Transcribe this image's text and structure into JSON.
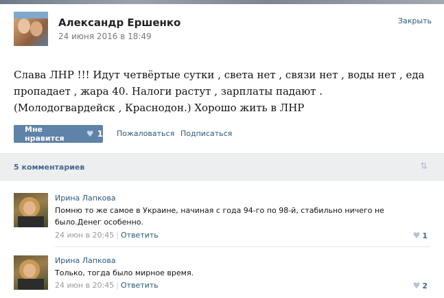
{
  "post": {
    "author_name": "Александр Ершенко",
    "date": "24 июня 2016 в 18:49",
    "close_label": "Закрыть",
    "text": "Слава ЛНР !!! Идут четвёртые сутки , света нет , связи нет , воды нет , еда пропадает , жара 40. Налоги растут , зарплаты падают . (Молодогвардейск , Краснодон.) Хорошо жить в ЛНР",
    "like_label": "Мне нравится",
    "like_count": "1",
    "complain_label": "Пожаловаться",
    "subscribe_label": "Подписаться"
  },
  "comments_header": {
    "count_label": "5 комментариев",
    "sort_icon": "sort-arrows-icon"
  },
  "comments": [
    {
      "author": "Ирина Лапкова",
      "text": "Помню то же самое в Украине, начиная с года 94-го по 98-й, стабильно ничего не было.Денег особенно.",
      "date": "24 июн в 20:45",
      "separator": "|",
      "reply_label": "Ответить",
      "likes": "1"
    },
    {
      "author": "Ирина Лапкова",
      "text": "Только, тогда было мирное время.",
      "date": "24 июн в 20:45",
      "separator": "|",
      "reply_label": "Ответить",
      "likes": "2"
    }
  ],
  "icons": {
    "heart": "heart-icon",
    "heart_glyph": "♥",
    "sort_glyph": "⇅"
  }
}
